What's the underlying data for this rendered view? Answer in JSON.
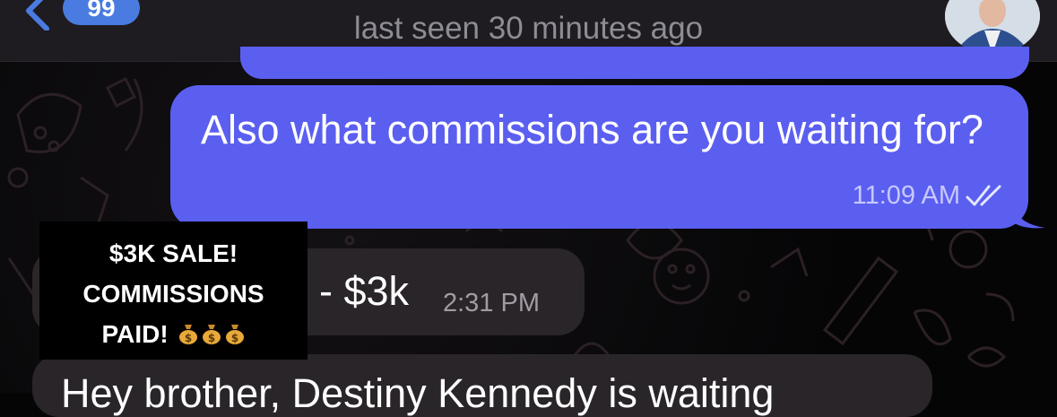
{
  "header": {
    "unread_count": "99",
    "status": "last seen 30 minutes ago",
    "back_icon": "chevron-left-icon",
    "avatar_icon": "contact-avatar"
  },
  "messages": [
    {
      "direction": "outgoing",
      "text": "Also what commissions are you waiting for?",
      "time": "11:09 AM",
      "status_icon": "double-check-icon"
    },
    {
      "direction": "incoming",
      "text": "- $3k",
      "time": "2:31 PM"
    },
    {
      "direction": "incoming",
      "text": "Hey brother, Destiny Kennedy is waiting"
    }
  ],
  "overlay": {
    "caption": "$3K SALE! COMMISSIONS PAID!",
    "caption_line1": "$3K SALE!",
    "caption_line2": "COMMISSIONS",
    "caption_line3": "PAID!",
    "emoji_icons": [
      "money-bag-icon",
      "money-bag-icon",
      "money-bag-icon"
    ]
  },
  "colors": {
    "outgoing_bubble": "#5b5ff0",
    "incoming_bubble": "#2a2529",
    "header_bg": "#1e1c21",
    "badge": "#4a7be0"
  }
}
